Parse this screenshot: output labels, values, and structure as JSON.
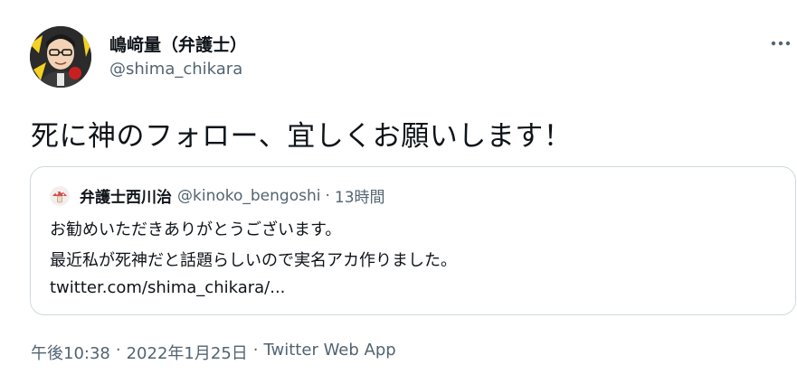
{
  "author": {
    "display_name": "嶋﨑量（弁護士）",
    "handle": "@shima_chikara"
  },
  "tweet": {
    "text": "死に神のフォロー、宜しくお願いします！"
  },
  "quote": {
    "author_name": "弁護士西川治",
    "author_handle": "@kinoko_bengoshi",
    "separator": "·",
    "time": "13時間",
    "lines": [
      "お勧めいただきありがとうございます。",
      "最近私が死神だと話題らしいので実名アカ作りました。",
      "twitter.com/shima_chikara/..."
    ]
  },
  "meta": {
    "time": "午後10:38",
    "date": "2022年1月25日",
    "source": "Twitter Web App",
    "separator": "·"
  },
  "icons": {
    "more": "more-dots-icon",
    "avatar": "author-avatar",
    "quote_avatar": "mushroom-avatar"
  },
  "colors": {
    "text_primary": "#0f1419",
    "text_secondary": "#536471",
    "border": "#cfd9de"
  }
}
